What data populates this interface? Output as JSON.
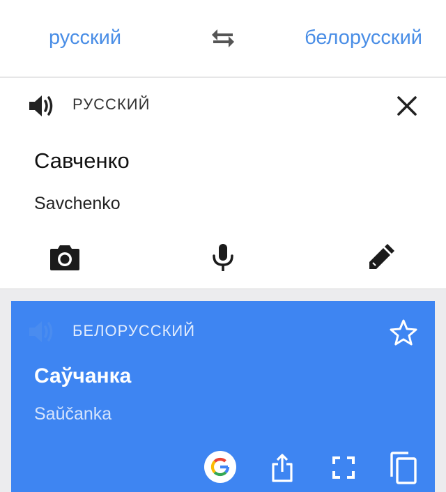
{
  "language_bar": {
    "source_language": "русский",
    "target_language": "белорусский",
    "swap_icon": "swap-arrows-icon"
  },
  "input_card": {
    "language_label": "РУССКИЙ",
    "text": "Савченко",
    "transliteration": "Savchenko",
    "icons": [
      "speaker-icon",
      "close-icon",
      "camera-icon",
      "microphone-icon",
      "pen-icon"
    ]
  },
  "output_card": {
    "language_label": "БЕЛОРУССКИЙ",
    "text": "Саўчанка",
    "transliteration": "Saŭčanka",
    "icons": [
      "speaker-icon",
      "star-icon",
      "google-logo-icon",
      "share-icon",
      "fullscreen-icon",
      "copy-icon"
    ]
  },
  "colors": {
    "accent": "#4a8ee6",
    "output_background": "#3e85f2",
    "page_background": "#ececee"
  }
}
